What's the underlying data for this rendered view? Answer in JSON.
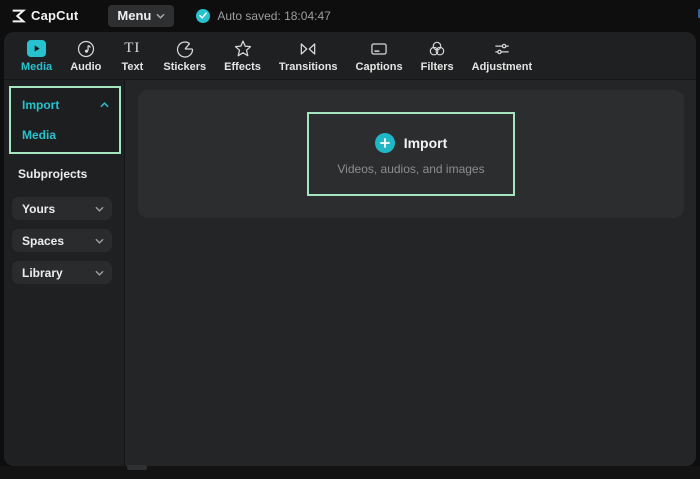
{
  "topbar": {
    "logo_text": "CapCut",
    "menu_label": "Menu",
    "autosave_text": "Auto saved: 18:04:47"
  },
  "toolbar": {
    "tabs": [
      {
        "label": "Media",
        "icon": "media-icon",
        "active": true
      },
      {
        "label": "Audio",
        "icon": "audio-icon",
        "active": false
      },
      {
        "label": "Text",
        "icon": "text-icon",
        "active": false
      },
      {
        "label": "Stickers",
        "icon": "stickers-icon",
        "active": false
      },
      {
        "label": "Effects",
        "icon": "effects-icon",
        "active": false
      },
      {
        "label": "Transitions",
        "icon": "transitions-icon",
        "active": false
      },
      {
        "label": "Captions",
        "icon": "captions-icon",
        "active": false
      },
      {
        "label": "Filters",
        "icon": "filters-icon",
        "active": false
      },
      {
        "label": "Adjustment",
        "icon": "adjustment-icon",
        "active": false
      }
    ]
  },
  "sidebar": {
    "import_group_label": "Import",
    "media_item_label": "Media",
    "subprojects_label": "Subprojects",
    "dropdowns": [
      {
        "label": "Yours"
      },
      {
        "label": "Spaces"
      },
      {
        "label": "Library"
      }
    ]
  },
  "main": {
    "import_button_label": "Import",
    "import_subtitle": "Videos, audios, and images"
  },
  "colors": {
    "accent_teal": "#27c2cf",
    "highlight_green": "#a4e5bf",
    "panel_bg": "#202122",
    "main_bg": "#242527",
    "dropzone_bg": "#2c2d2f"
  }
}
